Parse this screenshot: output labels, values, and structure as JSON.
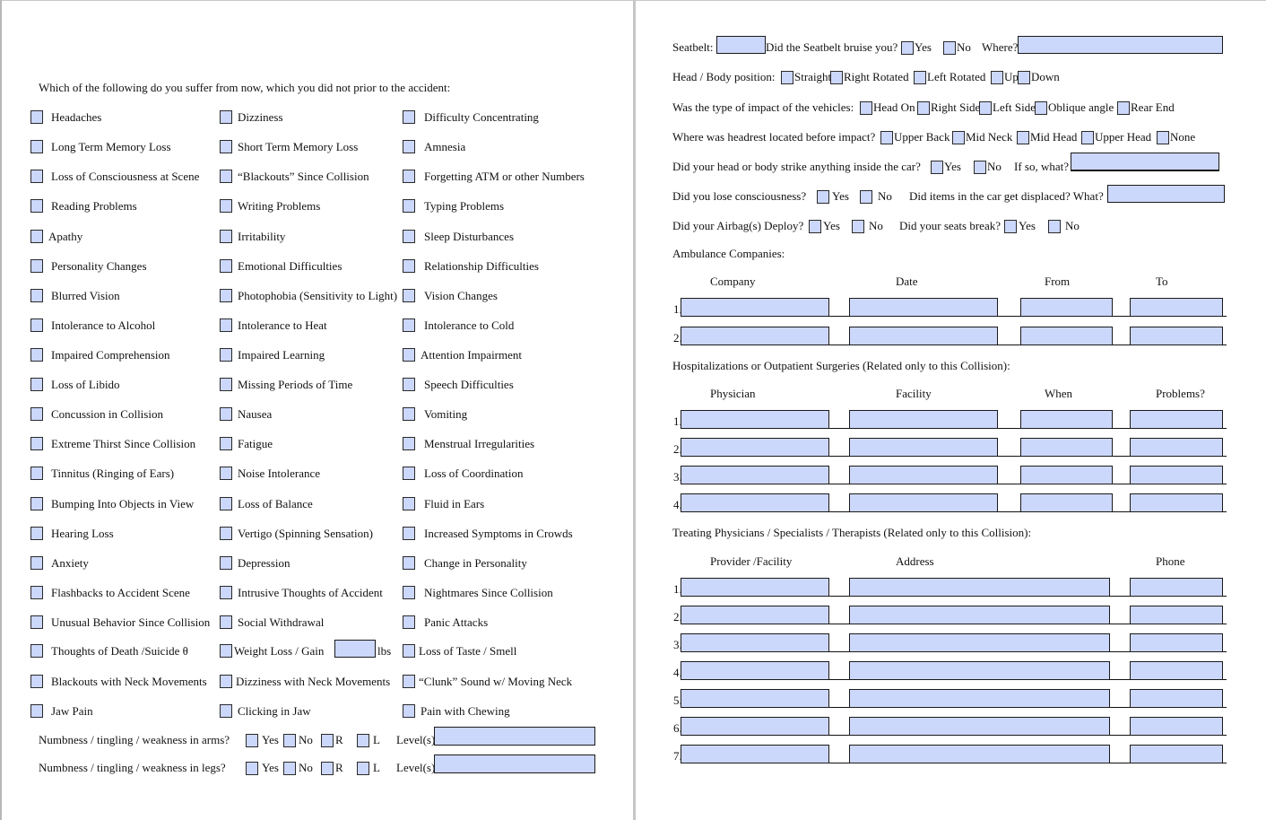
{
  "left": {
    "question": "Which of the following do you suffer from now, which you did not prior to the accident:",
    "symptoms": [
      [
        "Headaches",
        "Dizziness",
        "Difficulty Concentrating"
      ],
      [
        "Long Term Memory Loss",
        "Short Term Memory Loss",
        "Amnesia"
      ],
      [
        "Loss of Consciousness at Scene",
        "“Blackouts” Since Collision",
        "Forgetting ATM or other Numbers"
      ],
      [
        "Reading Problems",
        "Writing Problems",
        "Typing Problems"
      ],
      [
        "Apathy",
        "Irritability",
        "Sleep Disturbances"
      ],
      [
        "Personality Changes",
        "Emotional Difficulties",
        "Relationship Difficulties"
      ],
      [
        "Blurred Vision",
        "Photophobia (Sensitivity to Light)",
        "Vision Changes"
      ],
      [
        "Intolerance to Alcohol",
        "Intolerance to Heat",
        "Intolerance to Cold"
      ],
      [
        "Impaired Comprehension",
        "Impaired Learning",
        "Attention Impairment"
      ],
      [
        "Loss of Libido",
        "Missing Periods of Time",
        "Speech Difficulties"
      ],
      [
        "Concussion in Collision",
        "Nausea",
        "Vomiting"
      ],
      [
        "Extreme Thirst Since Collision",
        "Fatigue",
        "Menstrual Irregularities"
      ],
      [
        "Tinnitus (Ringing of Ears)",
        "Noise Intolerance",
        "Loss of Coordination"
      ],
      [
        "Bumping Into Objects in View",
        "Loss of Balance",
        "Fluid in Ears"
      ],
      [
        "Hearing Loss",
        "Vertigo (Spinning Sensation)",
        "Increased Symptoms in Crowds"
      ],
      [
        "Anxiety",
        "Depression",
        "Change in Personality"
      ],
      [
        "Flashbacks to Accident Scene",
        "Intrusive Thoughts of Accident",
        "Nightmares Since Collision"
      ],
      [
        "Unusual Behavior Since Collision",
        "Social Withdrawal",
        "Panic Attacks"
      ],
      [
        "Thoughts of Death /Suicide θ",
        "Weight Loss / Gain",
        "Loss of Taste / Smell"
      ],
      [
        "Blackouts with Neck Movements",
        "Dizziness with Neck Movements",
        "“Clunk” Sound w/ Moving Neck"
      ],
      [
        "Jaw Pain",
        "Clicking in Jaw",
        "Pain with Chewing"
      ]
    ],
    "weight_unit": "lbs",
    "weight_value": "",
    "numbness": [
      {
        "label": "Numbness / tingling / weakness in arms?",
        "yes": "Yes",
        "no": "No",
        "r": "R",
        "l": "L",
        "level_label": "Level(s)",
        "level_value": ""
      },
      {
        "label": "Numbness / tingling / weakness in legs?",
        "yes": "Yes",
        "no": "No",
        "r": "R",
        "l": "L",
        "level_label": "Level(s)",
        "level_value": ""
      }
    ]
  },
  "right": {
    "seatbelt_label": "Seatbelt:",
    "seatbelt_value": "",
    "bruise_q": "Did the Seatbelt bruise you?",
    "yes": "Yes",
    "no": "No",
    "where_label": "Where?",
    "where_value": "",
    "position_q": "Head / Body position:",
    "position_opts": [
      "Straight",
      "Right Rotated",
      "Left Rotated",
      "Up",
      "Down"
    ],
    "impact_q": "Was the type of impact of the vehicles:",
    "impact_opts": [
      "Head On",
      "Right Side",
      "Left Side",
      "Oblique angle",
      "Rear End"
    ],
    "headrest_q": "Where was headrest located before impact?",
    "headrest_opts": [
      "Upper Back",
      "Mid Neck",
      "Mid Head",
      "Upper Head",
      "None"
    ],
    "strike_q": "Did your head or body strike anything inside the car?",
    "strike_what": "If so, what?",
    "lose_q": "Did you lose consciousness?",
    "displaced_q": "Did items in the car get displaced? What?",
    "airbag_q": "Did your Airbag(s) Deploy?",
    "seats_q": "Did your seats break?",
    "ambulance": {
      "title": "Ambulance Companies:",
      "headers": [
        "Company",
        "Date",
        "From",
        "To"
      ],
      "rows": [
        "1.",
        "2."
      ]
    },
    "hospital": {
      "title": "Hospitalizations or Outpatient Surgeries (Related only to this Collision):",
      "headers": [
        "Physician",
        "Facility",
        "When",
        "Problems?"
      ],
      "rows": [
        "1.",
        "2.",
        "3.",
        "4."
      ]
    },
    "treating": {
      "title": "Treating Physicians / Specialists / Therapists (Related only to this Collision):",
      "headers": [
        "Provider /Facility",
        "Address",
        "Phone"
      ],
      "rows": [
        "1.",
        "2.",
        "3.",
        "4.",
        "5.",
        "6.",
        "7."
      ]
    }
  },
  "colors": {
    "field_fill": "#ccd7fc",
    "divider": "#c6c6c6"
  }
}
